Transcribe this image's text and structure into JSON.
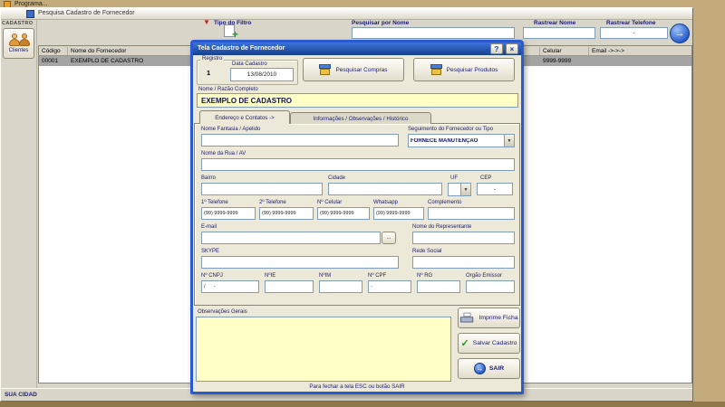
{
  "icons": {
    "plus": "+",
    "close": "×",
    "arrow": "→",
    "down": "▼",
    "check": "✓",
    "help": "?",
    "funnel": "▼"
  },
  "desktop": {
    "program_title": "Programa..."
  },
  "main_window": {
    "title": "Pesquisa Cadastro de Fornecedor",
    "filters": {
      "tipo_filtro_label": "Tipo do Filtro",
      "pesquisar_nome_label": "Pesquisar por Nome",
      "rastrear_nome_label": "Rastrear Nome",
      "rastrear_telefone_label": "Rastrear Telefone",
      "pesquisar_nome_value": "",
      "rastrear_nome_value": "",
      "rastrear_telefone_value": "-"
    },
    "sidebar": {
      "section_label": "CADASTRO",
      "clientes_label": "Clientes"
    },
    "table": {
      "col_codigo": "Código",
      "col_nome": "Nome do Fornecedor",
      "col_celular": "Celular",
      "col_email": "Email ->->->",
      "row": {
        "codigo": "00001",
        "nome": "EXEMPLO DE CADASTRO",
        "celular": "9999-9999"
      }
    },
    "status": "SUA CIDAD"
  },
  "dialog": {
    "title": "Tela Cadastro de Fornecedor",
    "registro": {
      "group_label": "Registro",
      "value": "1",
      "data_label": "Data Cadastro",
      "data_value": "13/08/2010"
    },
    "top_buttons": {
      "compras": "Pesquisar Compras",
      "produtos": "Pesquisar Produtos"
    },
    "nome": {
      "label": "Nome / Razão Completo",
      "value": "EXEMPLO DE CADASTRO"
    },
    "tabs": {
      "tab1": "Endereço e Contatos ->",
      "tab2": "Informações / Observações / Histórico"
    },
    "fields": {
      "fantasia_label": "Nome Fantasia / Apelido",
      "fantasia_value": "",
      "seguimento_label": "Seguimento do Fornecedor ou Tipo",
      "seguimento_value": "FORNECE MANUTENÇÃO",
      "rua_label": "Nome da Rua / AV",
      "rua_value": "",
      "bairro_label": "Bairro",
      "bairro_value": "",
      "cidade_label": "Cidade",
      "cidade_value": "",
      "uf_label": "UF",
      "uf_value": "",
      "cep_label": "CEP",
      "cep_value": "-",
      "tel1_label": "1º Telefone",
      "tel1_value": "(99) 9999-9999",
      "tel2_label": "2º Telefone",
      "tel2_value": "(99) 9999-9999",
      "celular_label": "Nº Celular",
      "celular_value": "(99) 9999-9999",
      "whatsapp_label": "Whatsapp",
      "whatsapp_value": "(99) 9999-9999",
      "complemento_label": "Complemento",
      "complemento_value": "",
      "email_label": "E-mail",
      "email_value": "",
      "email_button": "...",
      "representante_label": "Nome do Representante",
      "representante_value": "",
      "skype_label": "SKYPE",
      "skype_value": "",
      "rede_label": "Rede Social",
      "rede_value": "",
      "cnpj_label": "Nº CNPJ",
      "cnpj_value": "/      -",
      "ie_label": "NºIE",
      "ie_value": "",
      "im_label": "NºIM",
      "im_value": "",
      "cpf_label": "Nº CPF",
      "cpf_value": "-",
      "rg_label": "Nº RG",
      "rg_value": "",
      "orgao_label": "Orgão Emissor",
      "orgao_value": ""
    },
    "observacoes_label": "Observações Gerais",
    "observacoes_value": "",
    "action_buttons": {
      "imprimir": "Imprime Ficha",
      "salvar": "Salvar Cadastro",
      "sair": "SAIR"
    },
    "footer_hint": "Para fechar a tela ESC ou botão SAIR"
  }
}
